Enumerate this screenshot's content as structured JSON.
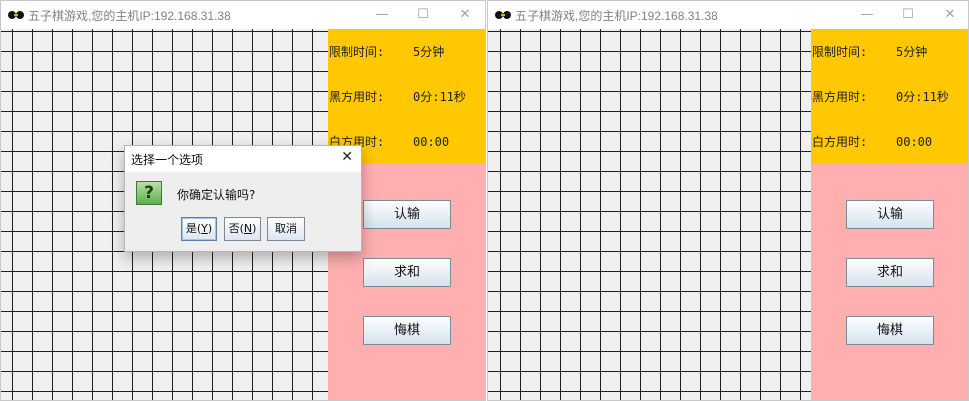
{
  "windows": [
    {
      "title": "五子棋游戏,您的主机IP:192.168.31.38",
      "info": {
        "time_limit_label": "限制时间:",
        "time_limit_value": "5分钟",
        "black_label": "黑方用时:",
        "black_value": "0分:11秒",
        "white_label": "白方用时:",
        "white_value": "00:00"
      },
      "buttons": {
        "resign": "认输",
        "draw": "求和",
        "undo": "悔棋"
      }
    },
    {
      "title": "五子棋游戏,您的主机IP:192.168.31.38",
      "info": {
        "time_limit_label": "限制时间:",
        "time_limit_value": "5分钟",
        "black_label": "黑方用时:",
        "black_value": "0分:11秒",
        "white_label": "白方用时:",
        "white_value": "00:00"
      },
      "buttons": {
        "resign": "认输",
        "draw": "求和",
        "undo": "悔棋"
      }
    }
  ],
  "window_controls": {
    "minimize": "—",
    "maximize": "☐",
    "close": "✕"
  },
  "dialog": {
    "title": "选择一个选项",
    "close": "✕",
    "icon": "?",
    "message": "你确定认输吗?",
    "yes_text": "是(",
    "yes_key": "Y",
    "yes_end": ")",
    "no_text": "否(",
    "no_key": "N",
    "no_end": ")",
    "cancel": "取消"
  },
  "colors": {
    "info_panel": "#ffc800",
    "control_panel": "#ffafaf",
    "board": "#f0f0f0"
  }
}
